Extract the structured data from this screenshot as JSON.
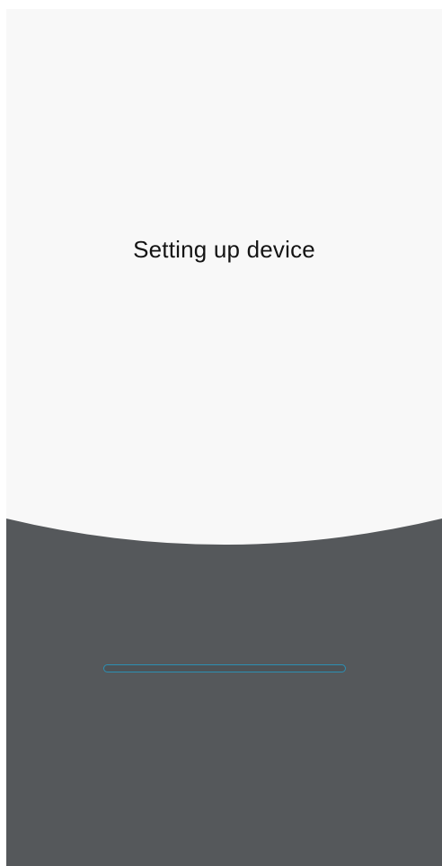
{
  "setup": {
    "title": "Setting up device",
    "progress_fraction": 0
  },
  "colors": {
    "top_background": "#f8f8f8",
    "bottom_background": "#55585b",
    "title_text": "#141414",
    "progress_accent": "#2c8fb3"
  }
}
